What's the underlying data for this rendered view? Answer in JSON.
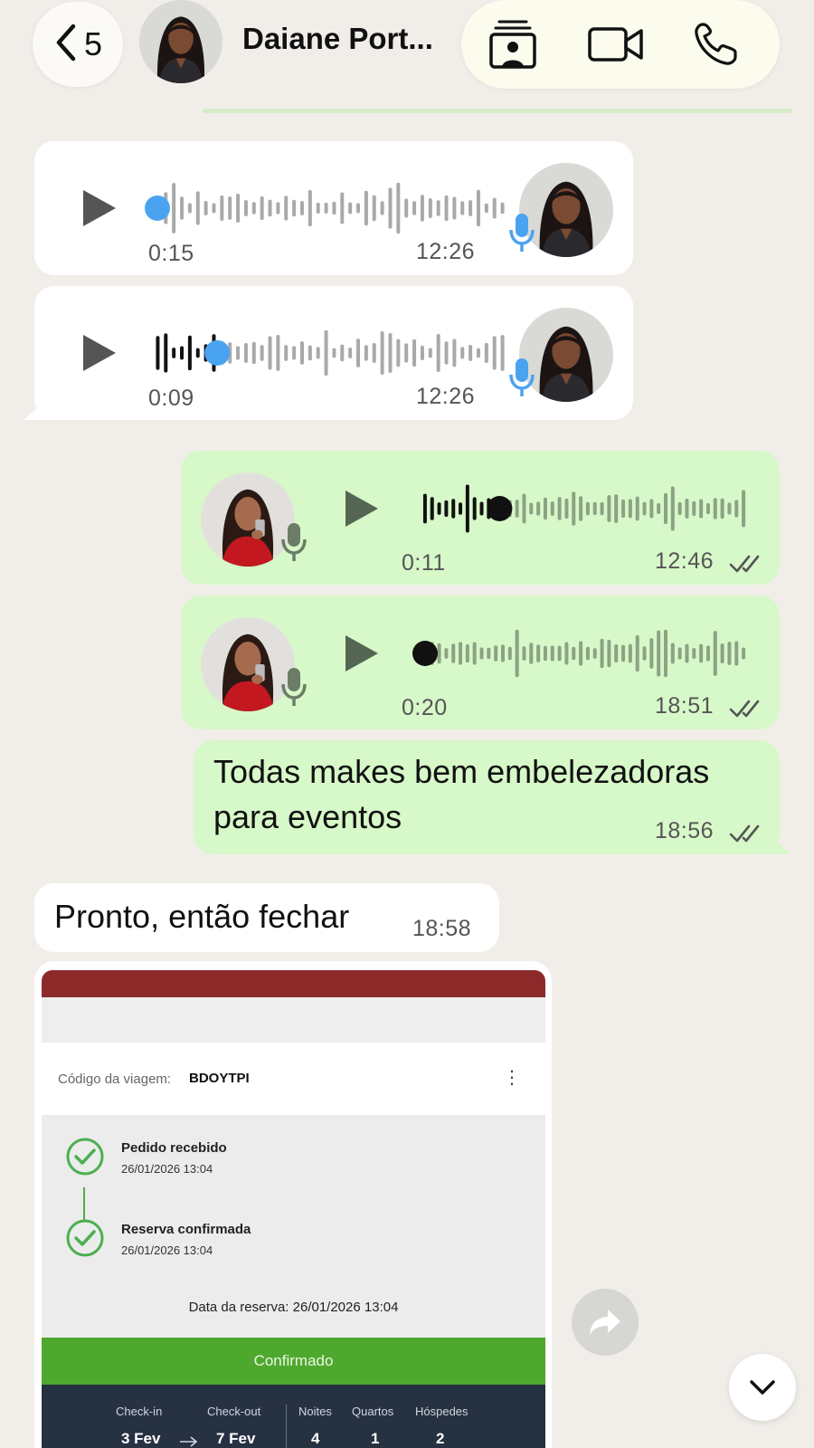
{
  "header": {
    "back_count": "5",
    "contact_name": "Daiane Port..."
  },
  "messages": [
    {
      "direction": "incoming",
      "type": "audio",
      "duration": "0:15",
      "time": "12:26",
      "progress": 0.0
    },
    {
      "direction": "incoming",
      "type": "audio",
      "duration": "0:09",
      "time": "12:26",
      "progress": 0.18
    },
    {
      "direction": "outgoing",
      "type": "audio",
      "duration": "0:11",
      "time": "12:46",
      "progress": 0.24,
      "status": "read"
    },
    {
      "direction": "outgoing",
      "type": "audio",
      "duration": "0:20",
      "time": "18:51",
      "progress": 0.0,
      "status": "read"
    },
    {
      "direction": "outgoing",
      "type": "text",
      "text": "Todas makes bem embelezadoras para eventos",
      "time": "18:56",
      "status": "read"
    },
    {
      "direction": "incoming",
      "type": "text",
      "text": "Pronto, então  fechar",
      "time": "18:58"
    }
  ],
  "receipt": {
    "trip_code_label": "Código da viagem:",
    "trip_code": "BDOYTPI",
    "steps": [
      {
        "title": "Pedido recebido",
        "date": "26/01/2026 13:04"
      },
      {
        "title": "Reserva confirmada",
        "date": "26/01/2026 13:04"
      }
    ],
    "booking_date_label": "Data da reserva:",
    "booking_date": "26/01/2026 13:04",
    "status": "Confirmado",
    "checkin_label": "Check-in",
    "checkin": "3 Fev",
    "checkout_label": "Check-out",
    "checkout": "7 Fev",
    "nights_label": "Noites",
    "nights": "4",
    "rooms_label": "Quartos",
    "rooms": "1",
    "guests_label": "Hóspedes",
    "guests": "2"
  },
  "colors": {
    "background": "#f1eee9",
    "incoming_bubble": "#ffffff",
    "outgoing_bubble": "#d7f8c8",
    "played_dot": "#4aa3f0",
    "confirmed_green": "#4fa82e"
  },
  "icons": [
    "chevron-left-icon",
    "contact-card-icon",
    "video-camera-icon",
    "phone-icon",
    "play-icon",
    "microphone-icon",
    "double-check-icon",
    "forward-icon",
    "chevron-down-icon",
    "check-circle-icon"
  ]
}
